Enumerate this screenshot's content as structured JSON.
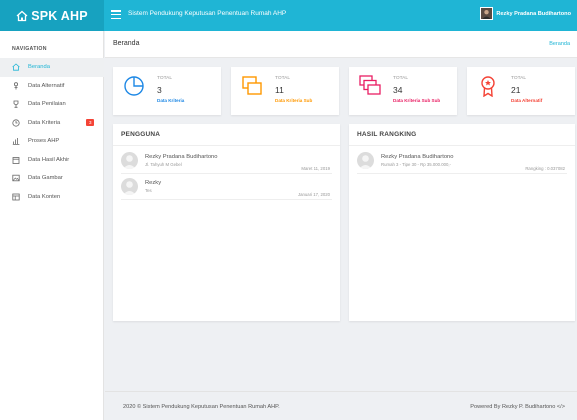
{
  "topbar": {
    "brand": "SPK AHP",
    "title": "Sistem Pendukung Keputusan Penentuan Rumah AHP",
    "user_name": "Rezky Pradana Budihartono"
  },
  "sidebar": {
    "heading": "NAVIGATION",
    "items": [
      {
        "label": "Beranda",
        "icon": "home-icon"
      },
      {
        "label": "Data Alternatif",
        "icon": "person-icon"
      },
      {
        "label": "Data Penilaian",
        "icon": "trophy-icon"
      },
      {
        "label": "Data Kriteria",
        "icon": "clock-icon",
        "badge": "3"
      },
      {
        "label": "Proses AHP",
        "icon": "bar-chart-icon"
      },
      {
        "label": "Data Hasil Akhir",
        "icon": "calendar-icon"
      },
      {
        "label": "Data Gambar",
        "icon": "image-icon"
      },
      {
        "label": "Data Konten",
        "icon": "layout-icon"
      }
    ]
  },
  "header": {
    "page_title": "Beranda",
    "breadcrumb": "Beranda"
  },
  "stats": [
    {
      "label": "TOTAL",
      "value": "3",
      "link": "Data Kriteria",
      "color": "#1e88e5",
      "icon": "pie-chart-icon"
    },
    {
      "label": "TOTAL",
      "value": "11",
      "link": "Data Kriteria Sub",
      "color": "#ff9800",
      "icon": "layers-icon"
    },
    {
      "label": "TOTAL",
      "value": "34",
      "link": "Data Kriteria Sub Sub",
      "color": "#e91e63",
      "icon": "stack-icon"
    },
    {
      "label": "TOTAL",
      "value": "21",
      "link": "Data Alternatif",
      "color": "#f44336",
      "icon": "award-icon"
    }
  ],
  "pengguna": {
    "title": "PENGGUNA",
    "rows": [
      {
        "name": "Rezky Pradana Budihartono",
        "desc": "Jl. Tahyuh M Gebel",
        "date": "Maret 11, 2019"
      },
      {
        "name": "Rezky",
        "desc": "Tes",
        "date": "Januari 17, 2020"
      }
    ]
  },
  "rangking": {
    "title": "HASIL RANGKING",
    "rows": [
      {
        "name": "Rezky Pradana Budihartono",
        "desc": "Rumah 3 - Tipe 30 - Rp 35.000.000,-",
        "date": "Rangking : 0.037082"
      }
    ]
  },
  "footer": {
    "left": "2020 © Sistem Pendukung Keputusan Penentuan Rumah AHP.",
    "right": "Powered By Rezky P. Budihartono </>"
  }
}
